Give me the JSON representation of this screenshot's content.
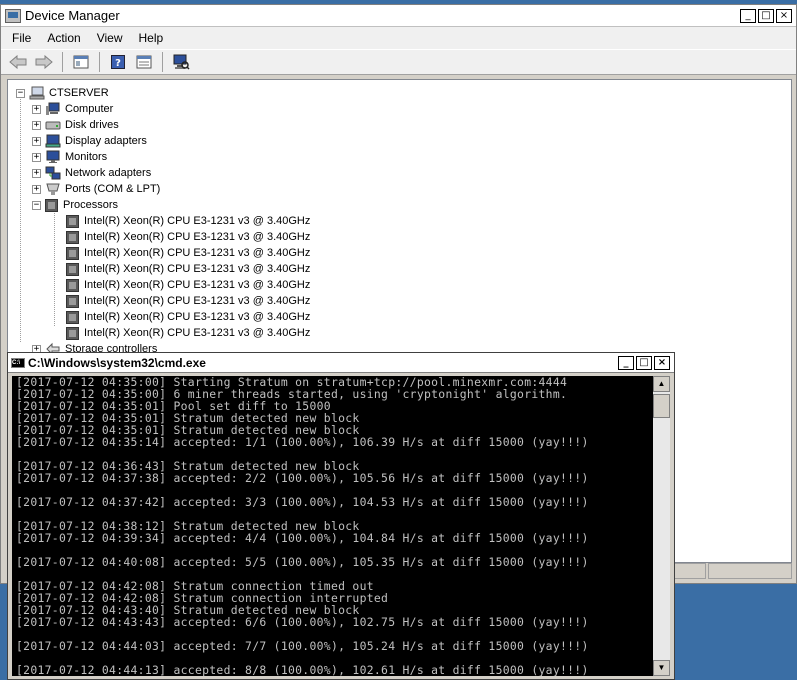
{
  "device_manager": {
    "title": "Device Manager",
    "menu": [
      "File",
      "Action",
      "View",
      "Help"
    ],
    "root": "CTSERVER",
    "categories": [
      {
        "label": "Computer",
        "icon": "computer-icon",
        "expanded": false
      },
      {
        "label": "Disk drives",
        "icon": "disk-drive-icon",
        "expanded": false
      },
      {
        "label": "Display adapters",
        "icon": "display-adapter-icon",
        "expanded": false
      },
      {
        "label": "Monitors",
        "icon": "monitor-icon",
        "expanded": false
      },
      {
        "label": "Network adapters",
        "icon": "network-adapter-icon",
        "expanded": false
      },
      {
        "label": "Ports (COM & LPT)",
        "icon": "port-icon",
        "expanded": false
      },
      {
        "label": "Processors",
        "icon": "processor-icon",
        "expanded": true
      },
      {
        "label": "Storage controllers",
        "icon": "storage-controller-icon",
        "expanded": false
      }
    ],
    "processors": [
      "Intel(R) Xeon(R) CPU E3-1231 v3 @ 3.40GHz",
      "Intel(R) Xeon(R) CPU E3-1231 v3 @ 3.40GHz",
      "Intel(R) Xeon(R) CPU E3-1231 v3 @ 3.40GHz",
      "Intel(R) Xeon(R) CPU E3-1231 v3 @ 3.40GHz",
      "Intel(R) Xeon(R) CPU E3-1231 v3 @ 3.40GHz",
      "Intel(R) Xeon(R) CPU E3-1231 v3 @ 3.40GHz",
      "Intel(R) Xeon(R) CPU E3-1231 v3 @ 3.40GHz",
      "Intel(R) Xeon(R) CPU E3-1231 v3 @ 3.40GHz"
    ]
  },
  "cmd": {
    "title": "C:\\Windows\\system32\\cmd.exe",
    "lines": [
      "[2017-07-12 04:35:00] Starting Stratum on stratum+tcp://pool.minexmr.com:4444",
      "[2017-07-12 04:35:00] 6 miner threads started, using 'cryptonight' algorithm.",
      "[2017-07-12 04:35:01] Pool set diff to 15000",
      "[2017-07-12 04:35:01] Stratum detected new block",
      "[2017-07-12 04:35:01] Stratum detected new block",
      "[2017-07-12 04:35:14] accepted: 1/1 (100.00%), 106.39 H/s at diff 15000 (yay!!!)",
      "",
      "[2017-07-12 04:36:43] Stratum detected new block",
      "[2017-07-12 04:37:38] accepted: 2/2 (100.00%), 105.56 H/s at diff 15000 (yay!!!)",
      "",
      "[2017-07-12 04:37:42] accepted: 3/3 (100.00%), 104.53 H/s at diff 15000 (yay!!!)",
      "",
      "[2017-07-12 04:38:12] Stratum detected new block",
      "[2017-07-12 04:39:34] accepted: 4/4 (100.00%), 104.84 H/s at diff 15000 (yay!!!)",
      "",
      "[2017-07-12 04:40:08] accepted: 5/5 (100.00%), 105.35 H/s at diff 15000 (yay!!!)",
      "",
      "[2017-07-12 04:42:08] Stratum connection timed out",
      "[2017-07-12 04:42:08] Stratum connection interrupted",
      "[2017-07-12 04:43:40] Stratum detected new block",
      "[2017-07-12 04:43:43] accepted: 6/6 (100.00%), 102.75 H/s at diff 15000 (yay!!!)",
      "",
      "[2017-07-12 04:44:03] accepted: 7/7 (100.00%), 105.24 H/s at diff 15000 (yay!!!)",
      "",
      "[2017-07-12 04:44:13] accepted: 8/8 (100.00%), 102.61 H/s at diff 15000 (yay!!!)"
    ]
  },
  "colors": {
    "desktop": "#3a6ea5",
    "console_bg": "#000000",
    "console_text": "#c0c0c0"
  }
}
